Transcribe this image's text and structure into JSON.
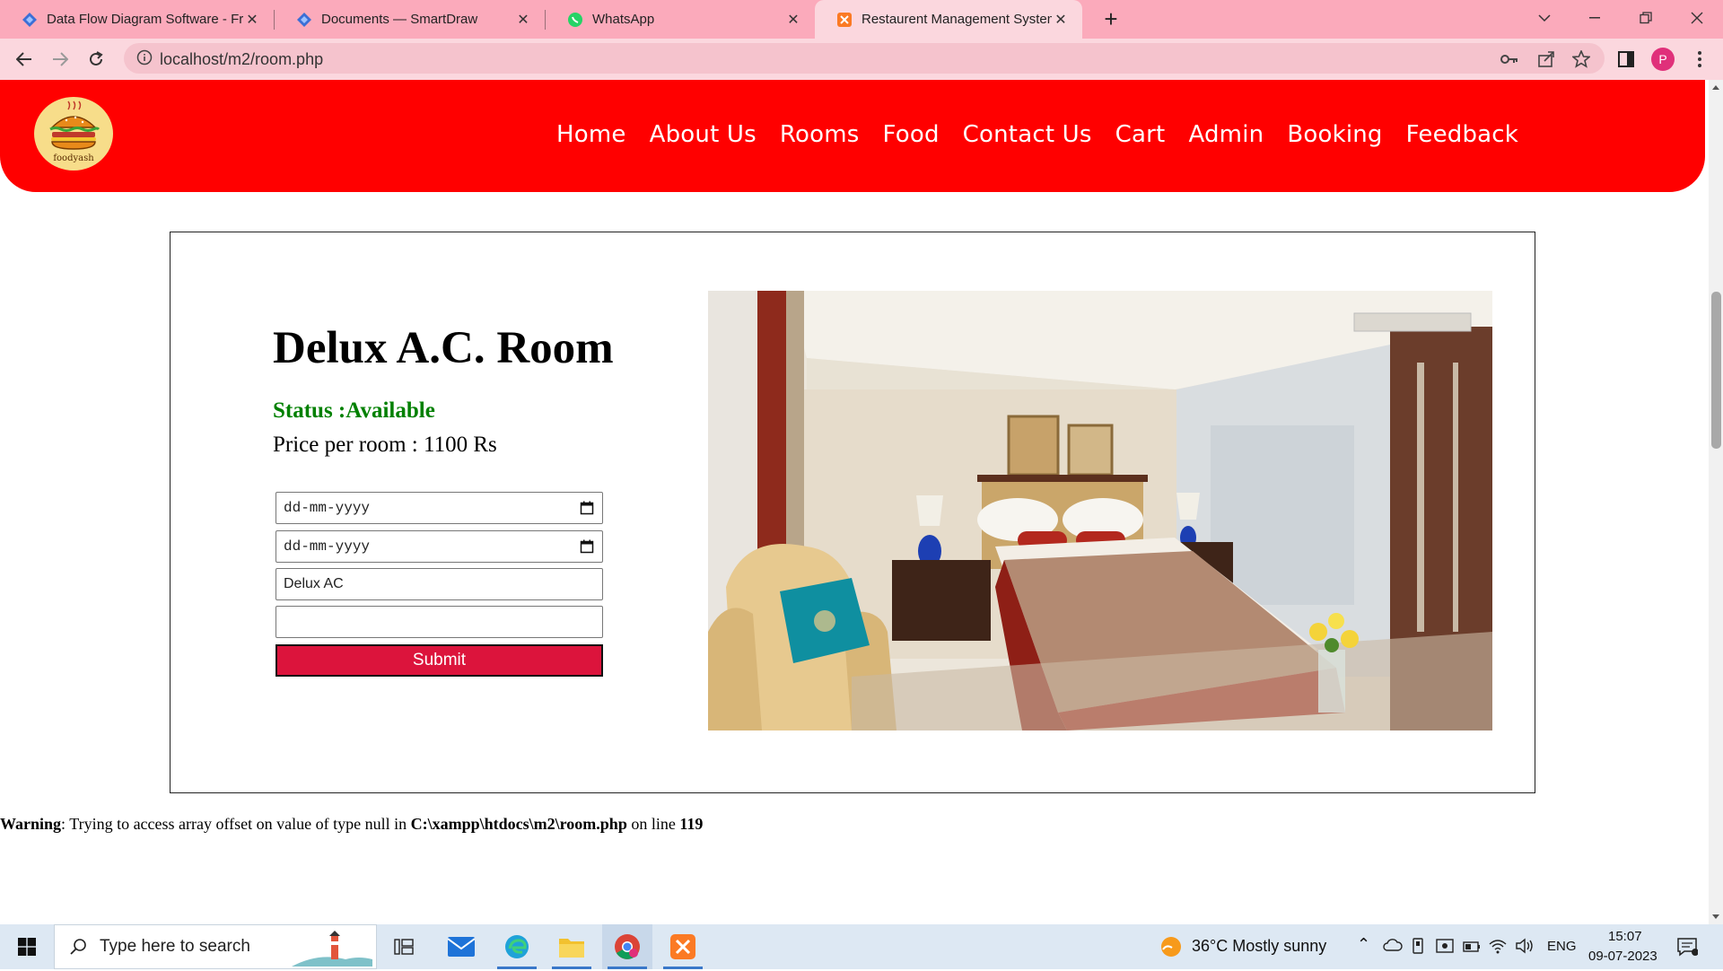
{
  "browser": {
    "tabs": [
      {
        "title": "Data Flow Diagram Software - Fr",
        "icon": "smartdraw-icon"
      },
      {
        "title": "Documents — SmartDraw",
        "icon": "smartdraw-icon"
      },
      {
        "title": "WhatsApp",
        "icon": "whatsapp-icon"
      },
      {
        "title": "Restaurent Management System",
        "icon": "xampp-icon",
        "active": true
      }
    ],
    "url": "localhost/m2/room.php",
    "profile_initial": "P"
  },
  "site": {
    "logo_text": "foodyash",
    "nav": [
      "Home",
      "About Us",
      "Rooms",
      "Food",
      "Contact Us",
      "Cart",
      "Admin",
      "Booking",
      "Feedback"
    ],
    "nav_bg": "#ff0000"
  },
  "room": {
    "title": "Delux A.C. Room",
    "status": "Status :Available",
    "price": "Price per room : 1100 Rs",
    "form": {
      "checkin_placeholder": "dd-mm-yyyy",
      "checkout_placeholder": "dd-mm-yyyy",
      "room_type_value": "Delux AC",
      "extra_value": "",
      "submit_label": "Submit"
    }
  },
  "warning": {
    "label": "Warning",
    "message": ": Trying to access array offset on value of type null in ",
    "path": "C:\\xampp\\htdocs\\m2\\room.php",
    "on_line": " on line ",
    "line": "119"
  },
  "taskbar": {
    "search_placeholder": "Type here to search",
    "weather": "36°C  Mostly sunny",
    "language": "ENG",
    "time": "15:07",
    "date": "09-07-2023"
  }
}
